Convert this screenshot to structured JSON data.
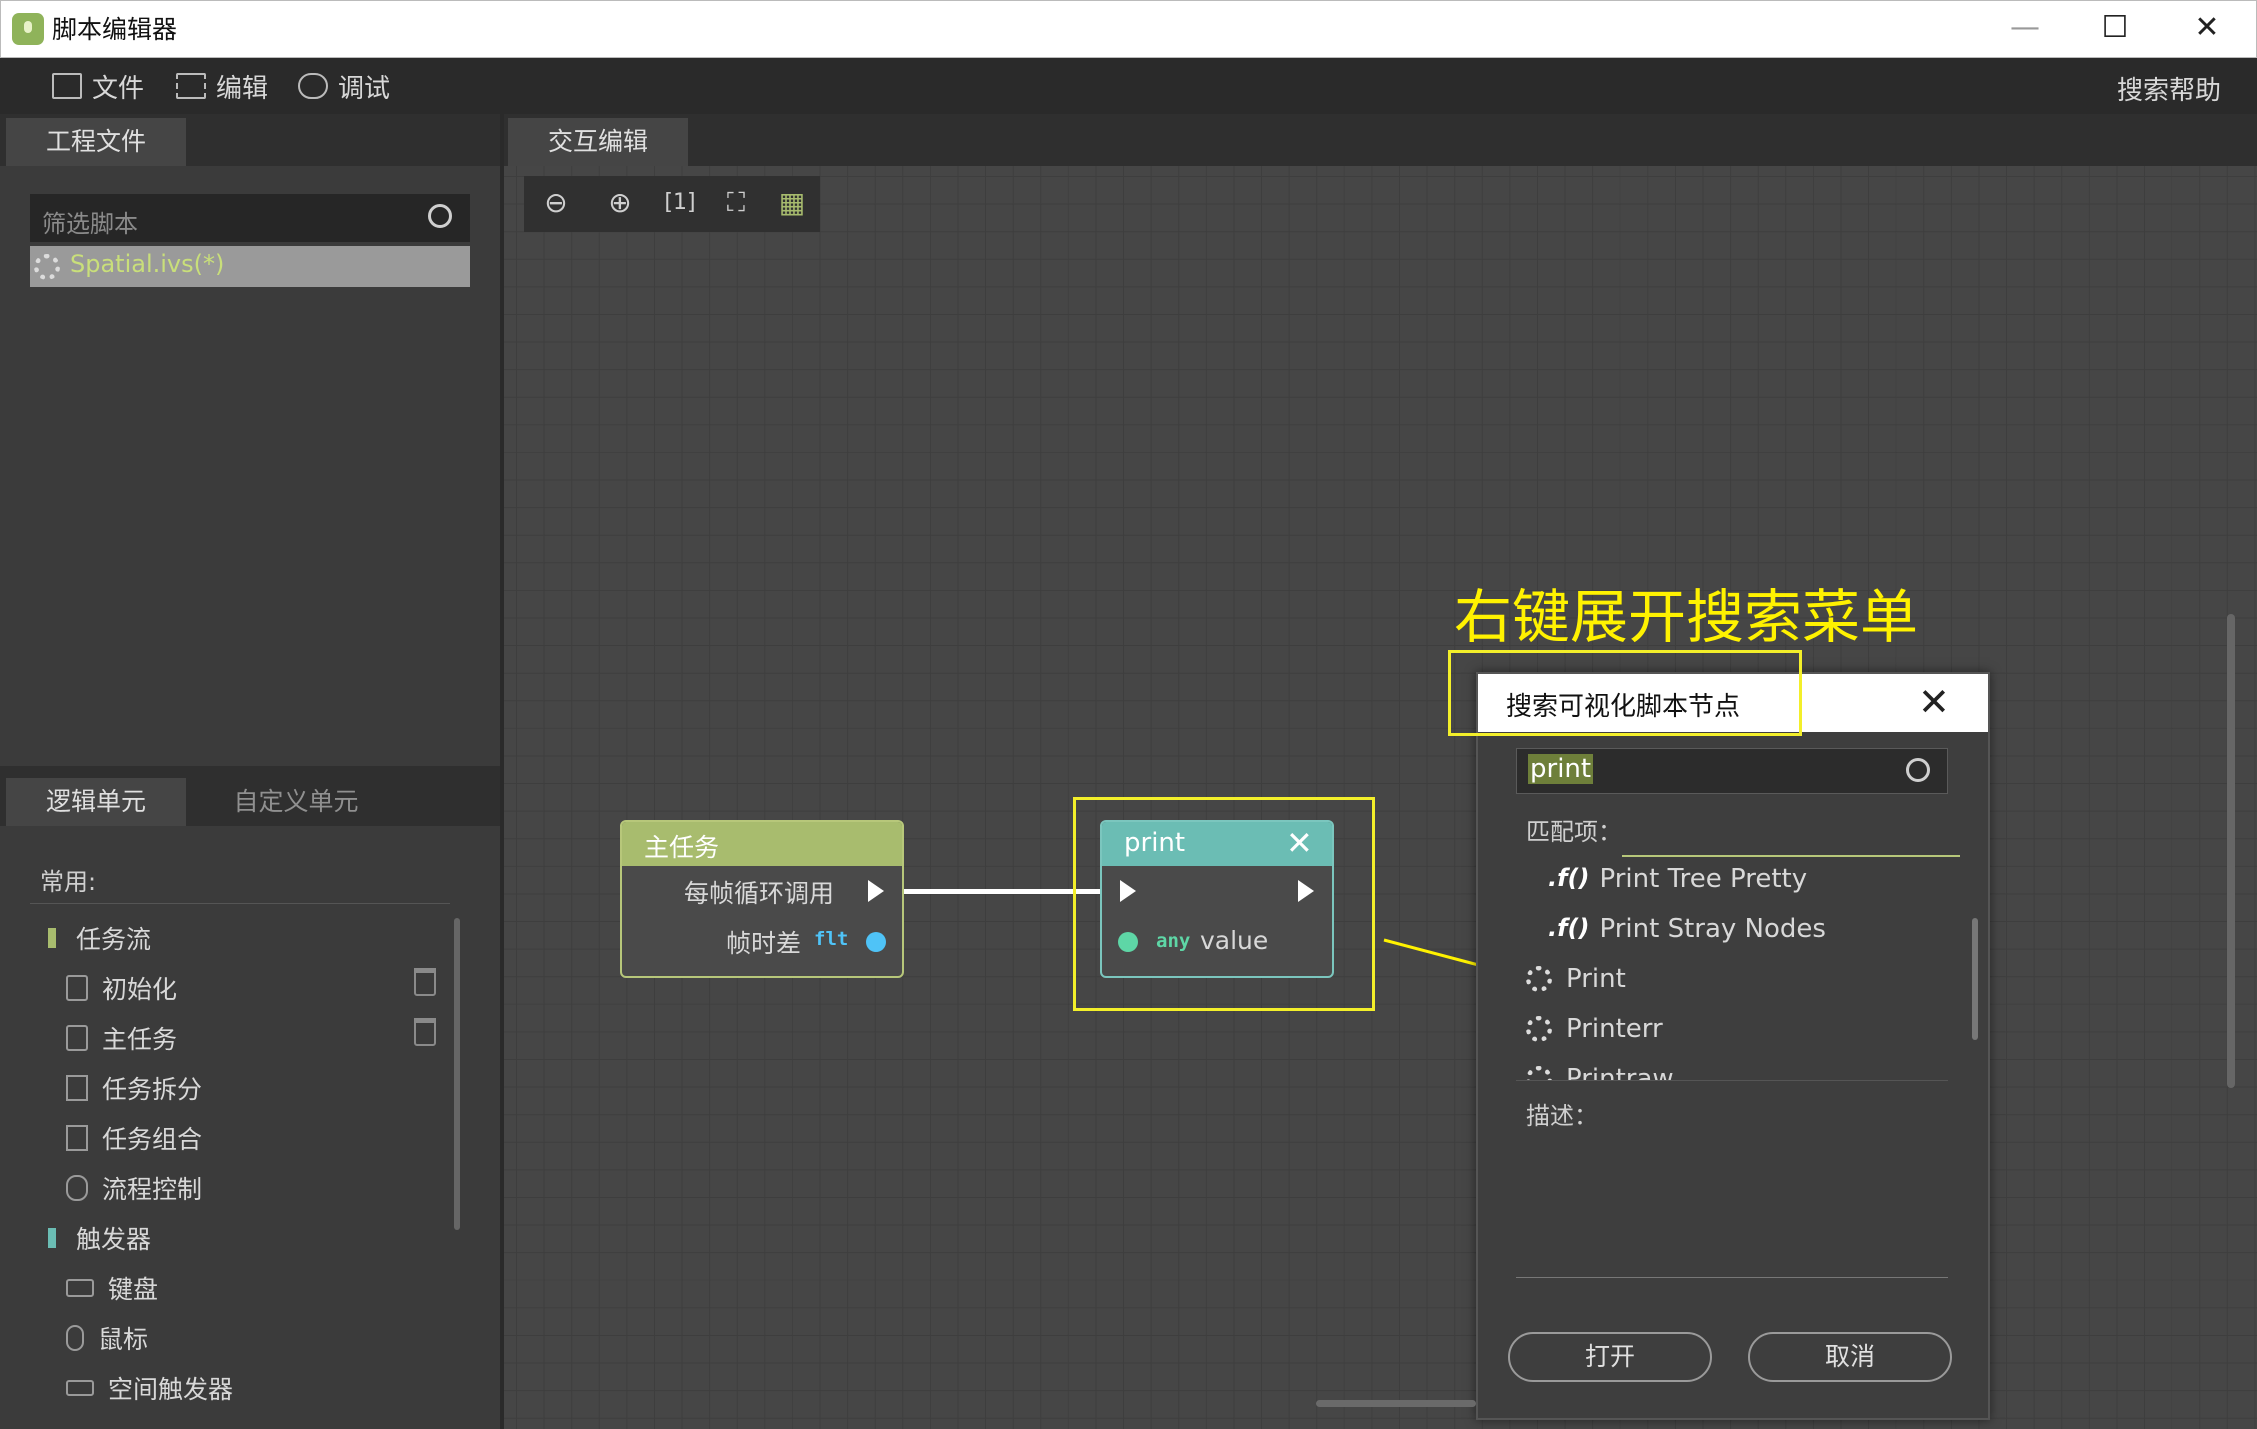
{
  "window": {
    "title": "脚本编辑器",
    "controls": [
      "—",
      "☐",
      "✕"
    ]
  },
  "menu": {
    "file": "文件",
    "edit": "编辑",
    "debug": "调试",
    "help": "搜索帮助"
  },
  "project_panel": {
    "tab": "工程文件",
    "filter_placeholder": "筛选脚本",
    "file": "Spatial.ivs(*)"
  },
  "logic_panel": {
    "tabs": [
      "逻辑单元",
      "自定义单元"
    ],
    "common_label": "常用:",
    "groups": [
      {
        "label": "任务流",
        "color": "#a8bc6e",
        "items": [
          "初始化",
          "主任务",
          "任务拆分",
          "任务组合",
          "流程控制"
        ]
      },
      {
        "label": "触发器",
        "color": "#6bbdb4",
        "items": [
          "键盘",
          "鼠标",
          "空间触发器"
        ]
      }
    ]
  },
  "canvas": {
    "tab": "交互编辑"
  },
  "nodes": {
    "main": {
      "title": "主任务",
      "exec_out": "每帧循环调用",
      "delta_label": "帧时差",
      "delta_type": "flt"
    },
    "print": {
      "title": "print",
      "param_type": "any",
      "param_name": "value"
    }
  },
  "annotation": {
    "text": "右键展开搜索菜单"
  },
  "search_dialog": {
    "title": "搜索可视化脚本节点",
    "query": "print",
    "match_label": "匹配项：",
    "results": [
      {
        "icon": "function-icon",
        "label": "Print Tree Pretty"
      },
      {
        "icon": "function-icon",
        "label": "Print Stray Nodes"
      },
      {
        "icon": "vs-gear-icon",
        "label": "Print"
      },
      {
        "icon": "vs-gear-icon",
        "label": "Printerr"
      },
      {
        "icon": "vs-gear-icon",
        "label": "Printraw"
      }
    ],
    "description_label": "描述：",
    "open_button": "打开",
    "cancel_button": "取消"
  },
  "colors": {
    "task_flow": "#a8bc6e",
    "print_node": "#6bbdb4",
    "highlight": "#f3ef2a",
    "annotation": "#fff200",
    "float_type": "#4fc3f7"
  }
}
